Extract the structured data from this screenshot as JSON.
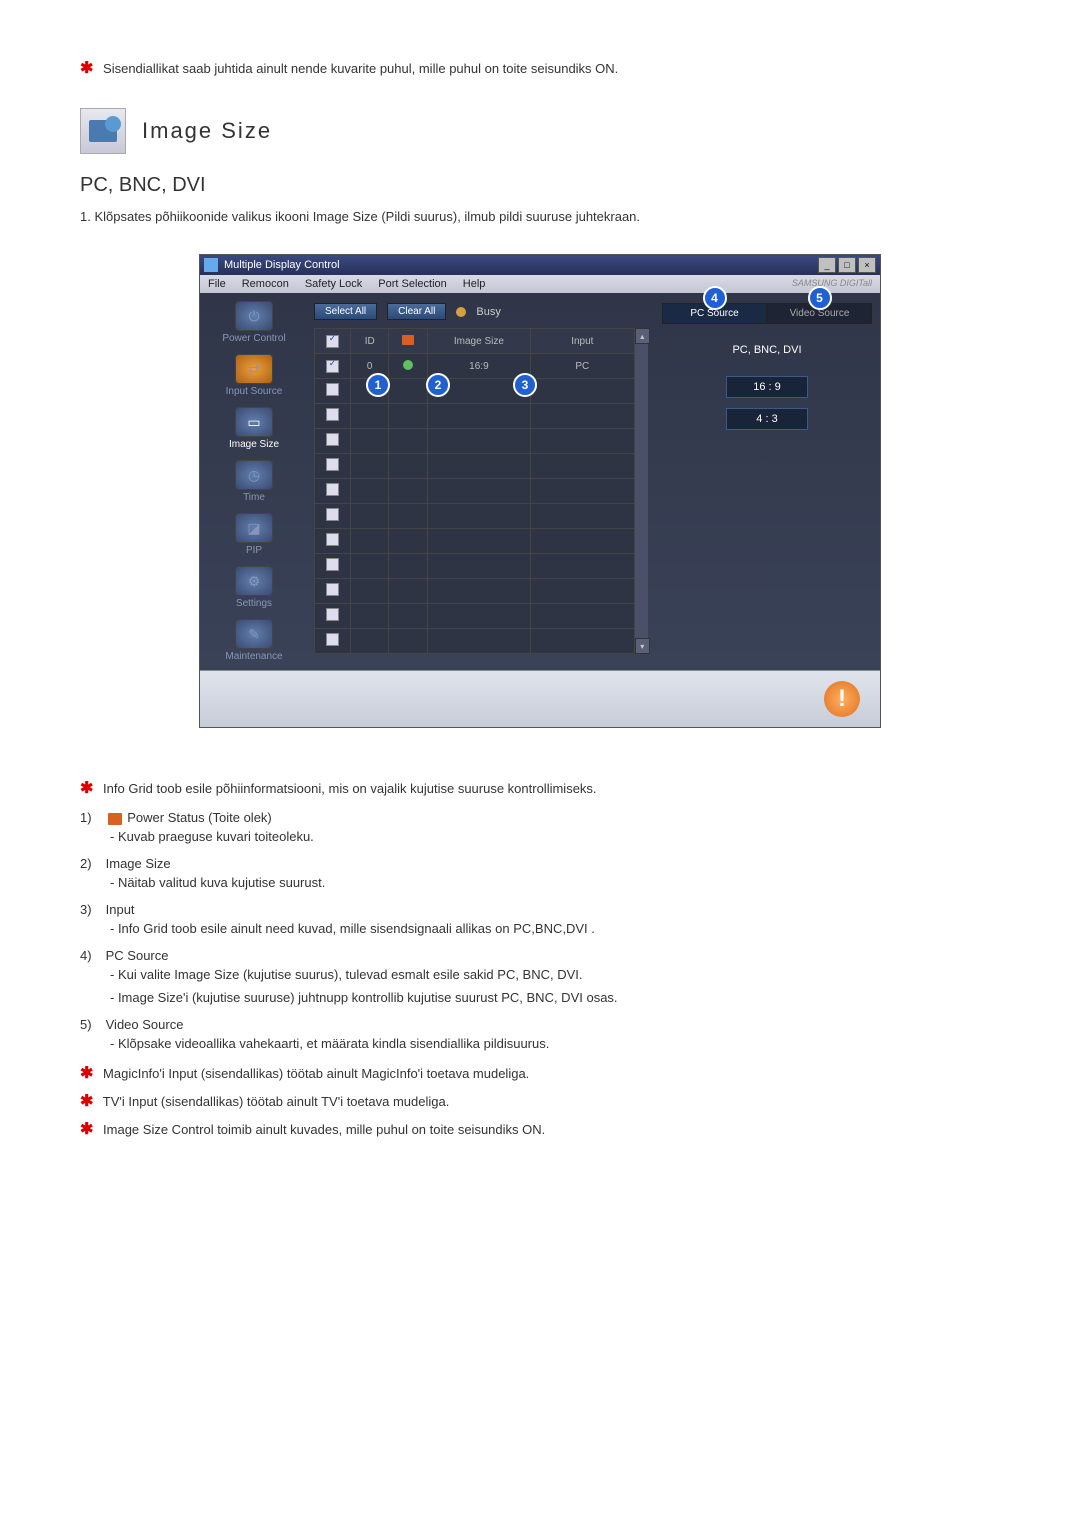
{
  "intro_note": "Sisendiallikat saab juhtida ainult nende kuvarite puhul, mille puhul on toite seisundiks ON.",
  "header_title": "Image Size",
  "subheading": "PC, BNC, DVI",
  "numbered_intro": "1.  Klõpsates põhiikoonide valikus ikooni Image Size (Pildi suurus), ilmub pildi suuruse juhtekraan.",
  "window": {
    "title": "Multiple Display Control",
    "menus": [
      "File",
      "Remocon",
      "Safety Lock",
      "Port Selection",
      "Help"
    ],
    "brand": "SAMSUNG DIGITall",
    "sidebar": [
      {
        "label": "Power Control"
      },
      {
        "label": "Input Source"
      },
      {
        "label": "Image Size"
      },
      {
        "label": "Time"
      },
      {
        "label": "PIP"
      },
      {
        "label": "Settings"
      },
      {
        "label": "Maintenance"
      }
    ],
    "toolbar": {
      "select_all": "Select All",
      "clear_all": "Clear All",
      "busy": "Busy"
    },
    "grid": {
      "headers": {
        "id": "ID",
        "image_size": "Image Size",
        "input": "Input"
      },
      "row": {
        "id": "0",
        "image_size": "16:9",
        "input": "PC"
      }
    },
    "right": {
      "tab_pc": "PC Source",
      "tab_video": "Video Source",
      "heading": "PC, BNC, DVI",
      "ratio_16_9": "16 : 9",
      "ratio_4_3": "4 : 3"
    },
    "callouts": {
      "c1": "1",
      "c2": "2",
      "c3": "3",
      "c4": "4",
      "c5": "5"
    }
  },
  "explanations": {
    "lead": "Info Grid toob esile põhiinformatsiooni, mis on vajalik kujutise suuruse kontrollimiseks.",
    "items": [
      {
        "num": "1)",
        "title": "Power Status (Toite olek)",
        "desc": "- Kuvab praeguse kuvari toiteoleku."
      },
      {
        "num": "2)",
        "title": "Image Size",
        "desc": "- Näitab valitud kuva kujutise suurust."
      },
      {
        "num": "3)",
        "title": "Input",
        "desc": "- Info Grid toob esile ainult need kuvad, mille sisendsignaali allikas on PC,BNC,DVI ."
      },
      {
        "num": "4)",
        "title": "PC Source",
        "desc": "- Kui valite Image Size (kujutise suurus), tulevad esmalt esile sakid PC, BNC, DVI.",
        "desc2": "- Image Size'i (kujutise suuruse) juhtnupp kontrollib kujutise suurust PC, BNC, DVI osas."
      },
      {
        "num": "5)",
        "title": "Video Source",
        "desc": "- Klõpsake videoallika vahekaarti, et määrata kindla sisendiallika pildisuurus."
      }
    ],
    "end_notes": [
      "MagicInfo'i Input (sisendallikas) töötab ainult MagicInfo'i toetava mudeliga.",
      "TV'i Input (sisendallikas) töötab ainult TV'i toetava mudeliga.",
      "Image Size Control toimib ainult kuvades, mille puhul on toite seisundiks ON."
    ]
  }
}
